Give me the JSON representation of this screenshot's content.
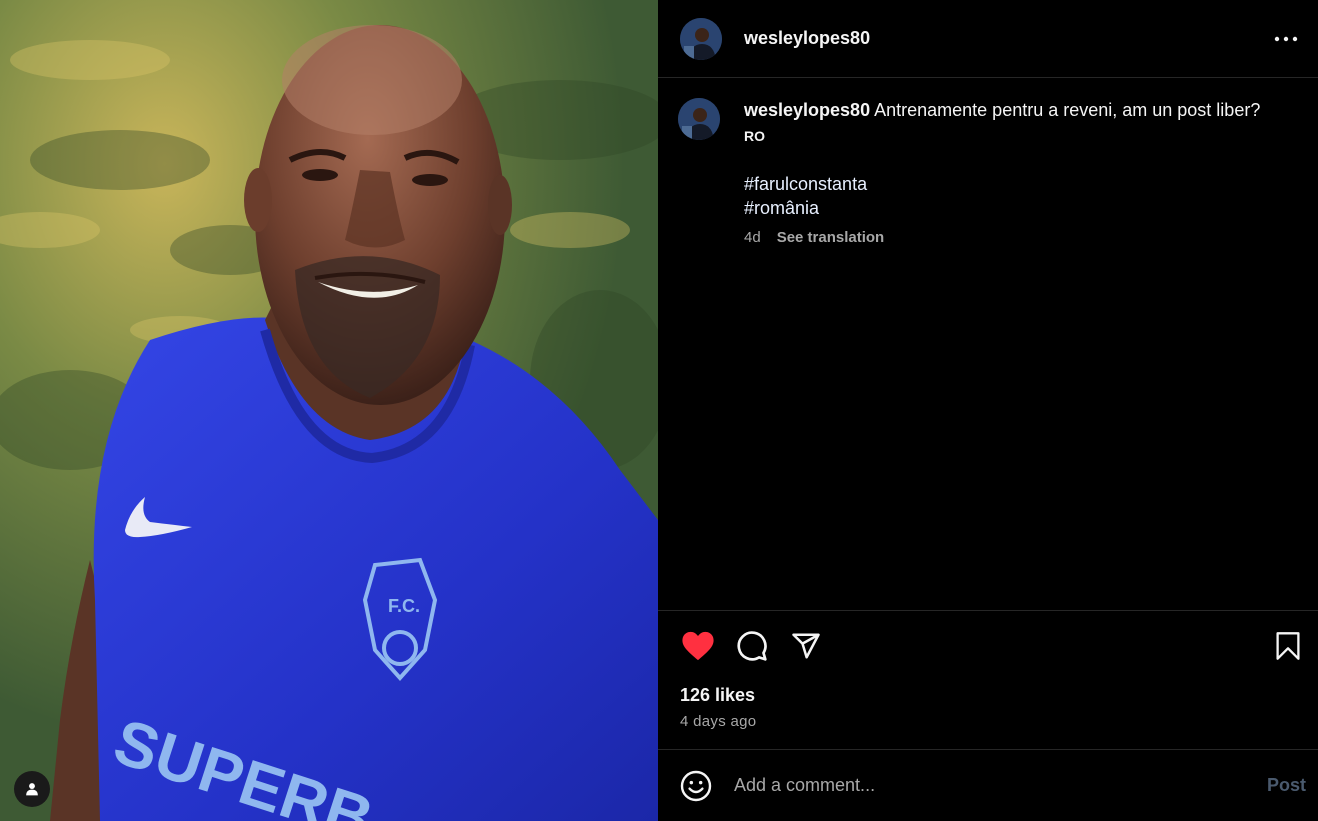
{
  "post": {
    "username": "wesleylopes80",
    "caption": "Antrenamente pentru a reveni, am un post liber?",
    "language_badge": "RO",
    "hashtags": [
      "#farulconstanta",
      "#românia"
    ],
    "age_short": "4d",
    "see_translation": "See translation",
    "likes": "126 likes",
    "age_long": "4 days ago",
    "liked": true
  },
  "comment_box": {
    "placeholder": "Add a comment...",
    "post_label": "Post"
  },
  "colors": {
    "background": "#000000",
    "divider": "#262626",
    "liked_heart": "#ff3040",
    "muted_text": "#a8a8a8",
    "post_button_disabled": "#4a5a6e",
    "shirt_blue": "#2d3ad6"
  },
  "icons": {
    "more": "more-horizontal-icon",
    "like": "heart-filled-icon",
    "comment": "comment-icon",
    "share": "send-icon",
    "save": "bookmark-icon",
    "emoji": "emoji-icon",
    "tagged_users": "user-icon"
  }
}
